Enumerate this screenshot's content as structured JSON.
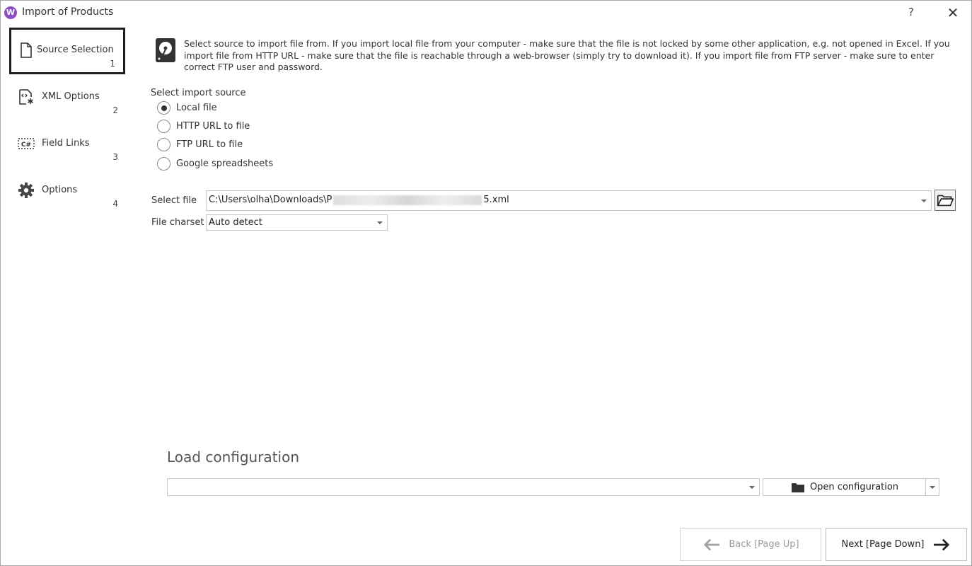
{
  "window": {
    "title": "Import of Products",
    "help": "?",
    "close": "✕",
    "app_icon_letter": "W"
  },
  "nav": [
    {
      "label": "Source Selection",
      "number": "1",
      "icon": "document-icon",
      "active": true
    },
    {
      "label": "XML Options",
      "number": "2",
      "icon": "xml-code-icon",
      "active": false
    },
    {
      "label": "Field Links",
      "number": "3",
      "icon": "field-links-icon",
      "active": false
    },
    {
      "label": "Options",
      "number": "4",
      "icon": "gear-icon",
      "active": false
    }
  ],
  "info": {
    "text": "Select source to import file from. If you import local file from your computer - make sure that the file is not locked by some other application, e.g. not opened in Excel. If you import file from HTTP URL - make sure that the file is reachable through a web-browser (simply try to download it). If you import file from FTP server - make sure to enter correct FTP user and password."
  },
  "source": {
    "label": "Select import source",
    "options": [
      {
        "label": "Local file",
        "checked": true
      },
      {
        "label": "HTTP URL to file",
        "checked": false
      },
      {
        "label": "FTP URL to file",
        "checked": false
      },
      {
        "label": "Google spreadsheets",
        "checked": false
      }
    ]
  },
  "file": {
    "label": "Select file",
    "value_prefix": "C:\\Users\\olha\\Downloads\\P",
    "value_suffix": "5.xml"
  },
  "charset": {
    "label": "File charset",
    "value": "Auto detect"
  },
  "load_config": {
    "title": "Load configuration",
    "value": "",
    "open_button": "Open configuration"
  },
  "footer": {
    "back": "Back [Page Up]",
    "next": "Next [Page Down]"
  }
}
